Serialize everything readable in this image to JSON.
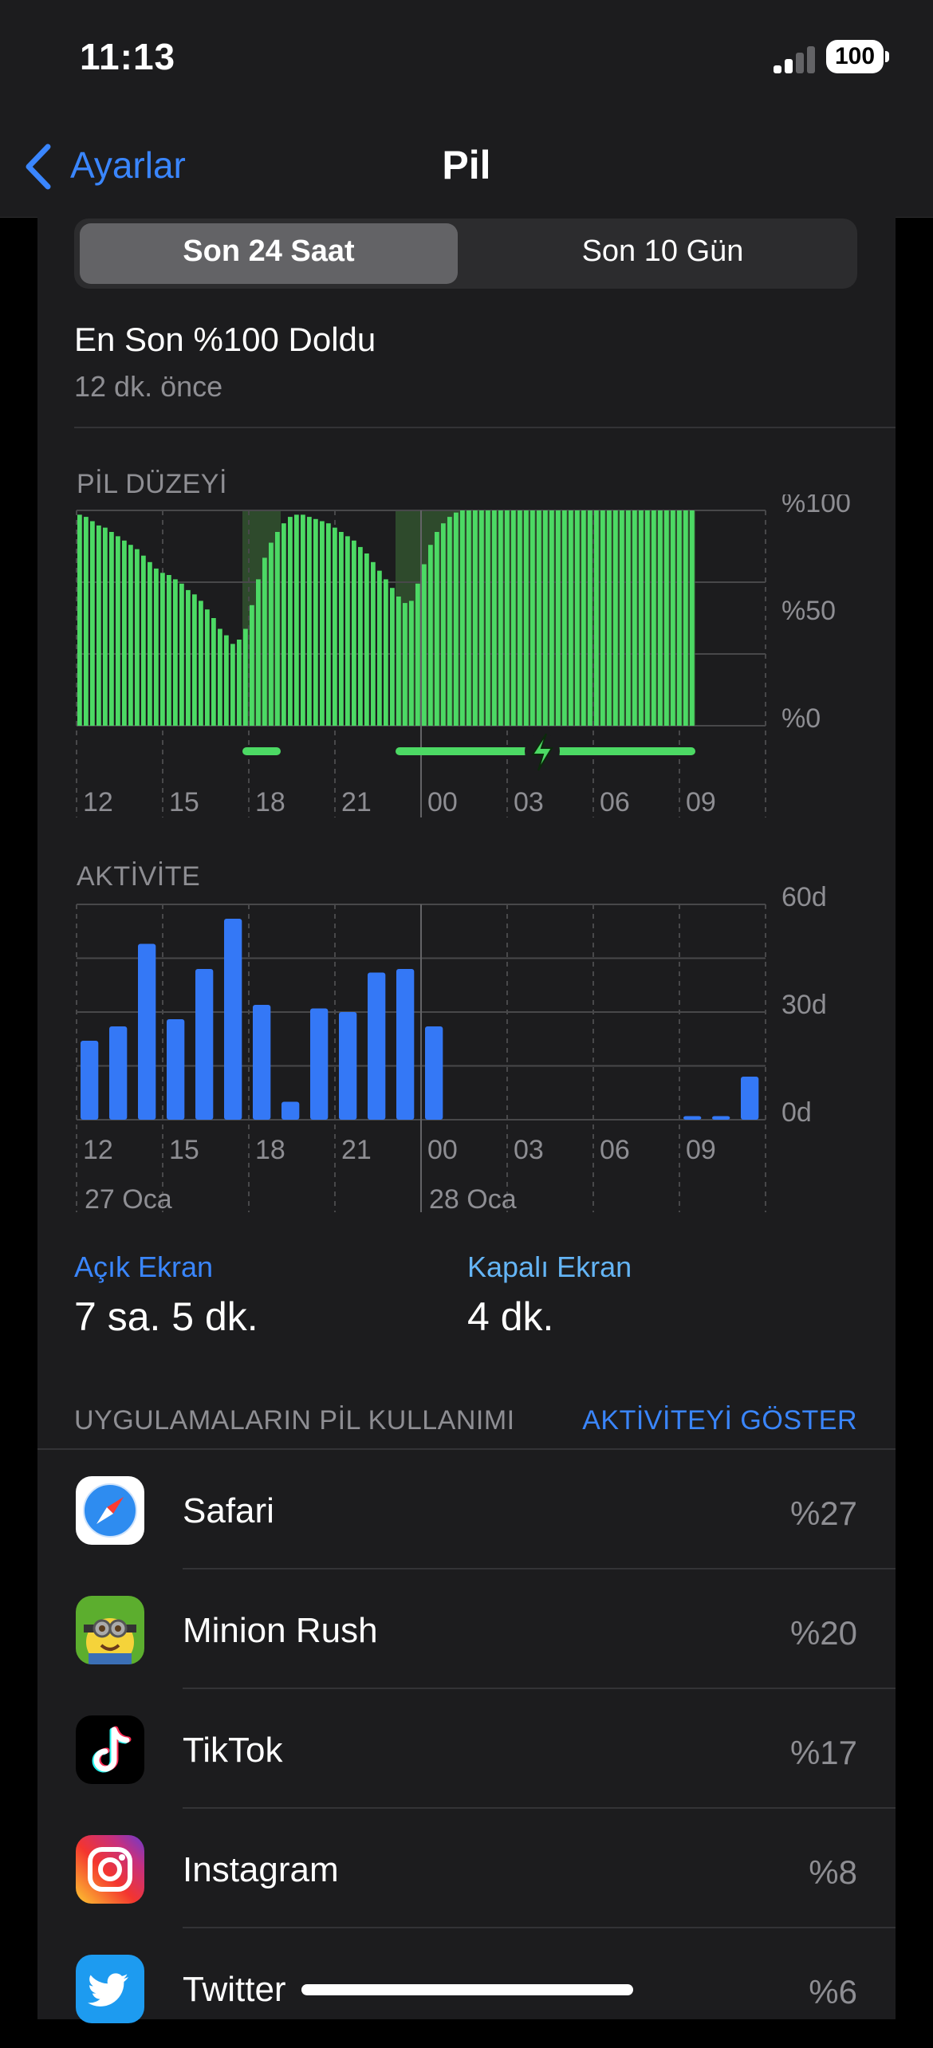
{
  "status_bar": {
    "time": "11:13",
    "battery": "100"
  },
  "nav": {
    "back_label": "Ayarlar",
    "title": "Pil"
  },
  "segment": {
    "options": [
      "Son 24 Saat",
      "Son 10 Gün"
    ],
    "selected": "Son 24 Saat"
  },
  "last_charge": {
    "title": "En Son %100 Doldu",
    "subtitle": "12 dk. önce"
  },
  "battery_chart": {
    "title": "PİL DÜZEYİ",
    "y_labels": [
      "%100",
      "%50",
      "%0"
    ],
    "x_labels": [
      "12",
      "15",
      "18",
      "21",
      "00",
      "03",
      "06",
      "09"
    ]
  },
  "activity_chart": {
    "title": "AKTİVİTE",
    "y_labels": [
      "60d",
      "30d",
      "0d"
    ],
    "x_labels": [
      "12",
      "15",
      "18",
      "21",
      "00",
      "03",
      "06",
      "09"
    ],
    "date_labels": [
      "27 Oca",
      "28 Oca"
    ]
  },
  "usage": {
    "screen_on_label": "Açık Ekran",
    "screen_on_value": "7 sa. 5 dk.",
    "screen_off_label": "Kapalı Ekran",
    "screen_off_value": "4 dk."
  },
  "apps_section": {
    "title": "UYGULAMALARIN PİL KULLANIMI",
    "action": "AKTİVİTEYİ GÖSTER"
  },
  "apps": [
    {
      "name": "Safari",
      "percent": "%27",
      "icon": "safari-icon"
    },
    {
      "name": "Minion Rush",
      "percent": "%20",
      "icon": "minion-rush-icon"
    },
    {
      "name": "TikTok",
      "percent": "%17",
      "icon": "tiktok-icon"
    },
    {
      "name": "Instagram",
      "percent": "%8",
      "icon": "instagram-icon"
    },
    {
      "name": "Twitter",
      "percent": "%6",
      "icon": "twitter-icon"
    }
  ],
  "chart_data": [
    {
      "type": "bar",
      "title": "PİL DÜZEYİ",
      "x_tick_labels": [
        "12",
        "15",
        "18",
        "21",
        "00",
        "03",
        "06",
        "09"
      ],
      "y_tick_labels": [
        "%0",
        "%50",
        "%100"
      ],
      "ylim": [
        0,
        100
      ],
      "values": [
        98,
        97,
        95,
        93,
        92,
        90,
        88,
        86,
        84,
        82,
        79,
        76,
        73,
        71,
        70,
        68,
        66,
        63,
        61,
        58,
        54,
        50,
        45,
        42,
        38,
        40,
        45,
        56,
        68,
        78,
        85,
        90,
        94,
        97,
        98,
        98,
        97,
        96,
        95,
        94,
        92,
        90,
        88,
        86,
        83,
        80,
        76,
        72,
        68,
        64,
        60,
        57,
        58,
        66,
        75,
        84,
        90,
        94,
        97,
        99,
        100,
        100,
        100,
        100,
        100,
        100,
        100,
        100,
        100,
        100,
        100,
        100,
        100,
        100,
        100,
        100,
        100,
        100,
        100,
        100,
        100,
        100,
        100,
        100,
        100,
        100,
        100,
        100,
        100,
        100,
        100,
        100,
        100,
        100,
        100,
        100,
        100
      ],
      "charging_periods": [
        [
          26,
          31
        ],
        [
          50,
          96
        ]
      ],
      "color": "#4cd964"
    },
    {
      "type": "bar",
      "title": "AKTİVİTE",
      "unit": "d",
      "x_tick_labels": [
        "12",
        "15",
        "18",
        "21",
        "00",
        "03",
        "06",
        "09"
      ],
      "y_tick_labels": [
        "0d",
        "30d",
        "60d"
      ],
      "ylim": [
        0,
        60
      ],
      "hourly_values": [
        22,
        26,
        49,
        28,
        42,
        56,
        32,
        5,
        31,
        30,
        41,
        42,
        26,
        0,
        0,
        0,
        0,
        0,
        0,
        0,
        0,
        1,
        1,
        12
      ],
      "color": "#3478f6"
    }
  ],
  "colors": {
    "accent": "#3a86ff",
    "battery_green": "#4cd964",
    "activity_blue": "#3478f6"
  }
}
